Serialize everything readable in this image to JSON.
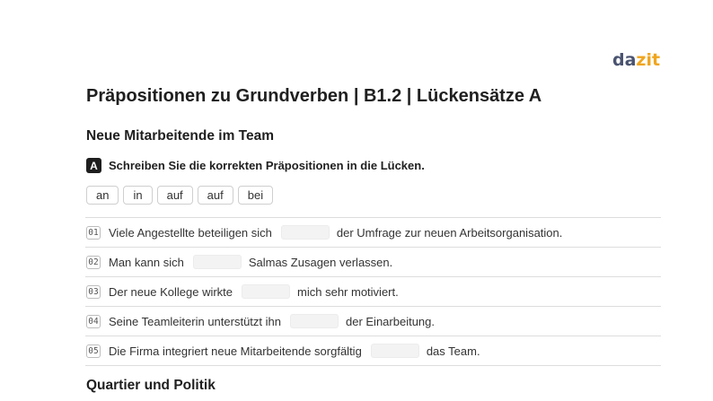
{
  "logo": {
    "part1": "da",
    "part2": "zit"
  },
  "title": "Präpositionen zu Grundverben | B1.2 | Lückensätze A",
  "section1": {
    "title": "Neue Mitarbeitende im Team"
  },
  "task": {
    "badge": "A",
    "instruction": "Schreiben Sie die korrekten Präpositionen in die Lücken."
  },
  "wordbank": [
    "an",
    "in",
    "auf",
    "auf",
    "bei"
  ],
  "rows": [
    {
      "num": "01",
      "before": "Viele Angestellte beteiligen sich",
      "after": "der Umfrage zur neuen Arbeitsorganisation."
    },
    {
      "num": "02",
      "before": "Man kann sich",
      "after": "Salmas Zusagen verlassen."
    },
    {
      "num": "03",
      "before": "Der neue Kollege wirkte",
      "after": "mich sehr motiviert."
    },
    {
      "num": "04",
      "before": "Seine Teamleiterin unterstützt ihn",
      "after": "der Einarbeitung."
    },
    {
      "num": "05",
      "before": "Die Firma integriert neue Mitarbeitende sorgfältig",
      "after": "das Team."
    }
  ],
  "section2": {
    "title": "Quartier und Politik"
  }
}
